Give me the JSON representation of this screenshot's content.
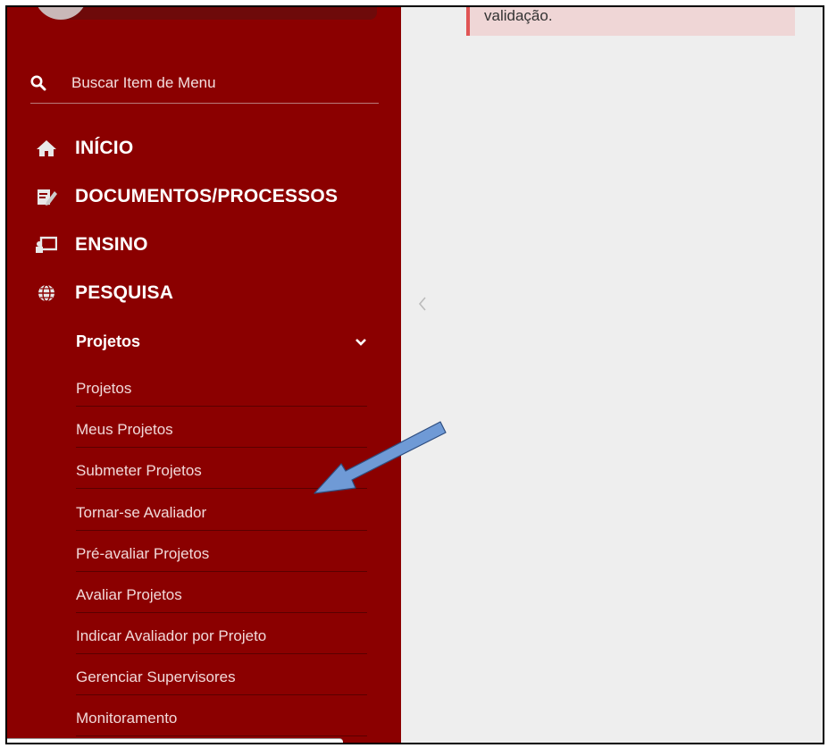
{
  "alert": {
    "text": "validação."
  },
  "search": {
    "label": "Buscar Item de Menu",
    "icon": "search-icon"
  },
  "menu": [
    {
      "label": "INÍCIO",
      "icon": "home-icon"
    },
    {
      "label": "DOCUMENTOS/PROCESSOS",
      "icon": "document-edit-icon"
    },
    {
      "label": "ENSINO",
      "icon": "teaching-board-icon"
    },
    {
      "label": "PESQUISA",
      "icon": "globe-icon"
    }
  ],
  "submenu": {
    "header": "Projetos",
    "items": [
      "Projetos",
      "Meus Projetos",
      "Submeter Projetos",
      "Tornar-se Avaliador",
      "Pré-avaliar Projetos",
      "Avaliar Projetos",
      "Indicar Avaliador por Projeto",
      "Gerenciar Supervisores",
      "Monitoramento"
    ]
  },
  "colors": {
    "sidebar": "#8b0000",
    "alert_bg": "#efd6d6",
    "alert_border": "#e05555",
    "annotation_arrow": "#6f9ad6"
  }
}
